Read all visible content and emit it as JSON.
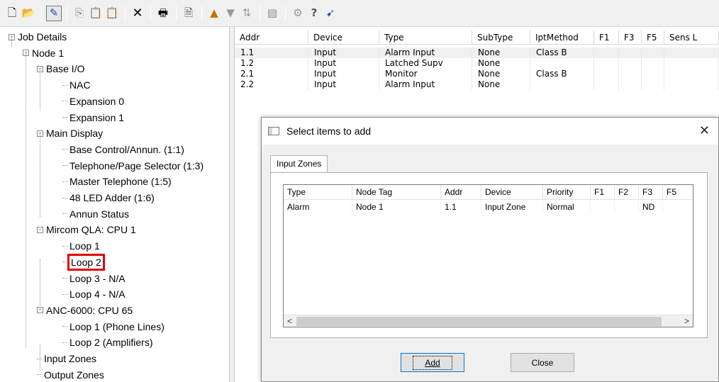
{
  "toolbar": {
    "groups": [
      [
        "new-doc-icon",
        "open-folder-icon"
      ],
      [
        "pencil-icon"
      ],
      [
        "copy-icon",
        "paste-icon",
        "paste-special-icon"
      ],
      [
        "delete-icon"
      ],
      [
        "print-icon"
      ],
      [
        "report-icon"
      ],
      [
        "upload-icon",
        "download-icon",
        "transfer-icon"
      ],
      [
        "config-icon"
      ],
      [
        "gear-icon",
        "help-icon",
        "context-help-icon"
      ]
    ]
  },
  "tree": {
    "items": [
      {
        "label": "Job Details",
        "depth": 0,
        "expander": "minus"
      },
      {
        "label": "Node 1",
        "depth": 1,
        "expander": "minus"
      },
      {
        "label": "Base I/O",
        "depth": 2,
        "expander": "minus"
      },
      {
        "label": "NAC",
        "depth": 3
      },
      {
        "label": "Expansion 0",
        "depth": 3
      },
      {
        "label": "Expansion 1",
        "depth": 3
      },
      {
        "label": "Main Display",
        "depth": 2,
        "expander": "minus"
      },
      {
        "label": "Base Control/Annun. (1:1)",
        "depth": 3
      },
      {
        "label": "Telephone/Page Selector (1:3)",
        "depth": 3
      },
      {
        "label": "Master Telephone (1:5)",
        "depth": 3
      },
      {
        "label": "48 LED Adder (1:6)",
        "depth": 3
      },
      {
        "label": "Annun Status",
        "depth": 3
      },
      {
        "label": "Mircom QLA: CPU 1",
        "depth": 2,
        "expander": "minus"
      },
      {
        "label": "Loop 1",
        "depth": 3
      },
      {
        "label": "Loop 2",
        "depth": 3,
        "highlighted": true
      },
      {
        "label": "Loop 3 - N/A",
        "depth": 3
      },
      {
        "label": "Loop 4 - N/A",
        "depth": 3
      },
      {
        "label": "ANC-6000: CPU 65",
        "depth": 2,
        "expander": "minus"
      },
      {
        "label": "Loop 1  (Phone Lines)",
        "depth": 3
      },
      {
        "label": "Loop 2  (Amplifiers)",
        "depth": 3
      },
      {
        "label": "Input Zones",
        "depth": 2
      },
      {
        "label": "Output Zones",
        "depth": 2
      }
    ]
  },
  "grid": {
    "headers": [
      "Addr",
      "Device",
      "Type",
      "SubType",
      "IptMethod",
      "F1",
      "F3",
      "F5",
      "Sens L"
    ],
    "rows": [
      [
        "1.1",
        "Input",
        "Alarm Input",
        "None",
        "Class B",
        "",
        "",
        "",
        ""
      ],
      [
        "1.2",
        "Input",
        "Latched Supv",
        "None",
        "",
        "",
        "",
        "",
        ""
      ],
      [
        "2.1",
        "Input",
        "Monitor",
        "None",
        "Class B",
        "",
        "",
        "",
        ""
      ],
      [
        "2.2",
        "Input",
        "Alarm Input",
        "None",
        "",
        "",
        "",
        "",
        ""
      ]
    ]
  },
  "dialog": {
    "title": "Select items to add",
    "close_glyph": "✕",
    "tab_label": "Input Zones",
    "list_headers": [
      "Type",
      "Node Tag",
      "Addr",
      "Device",
      "Priority",
      "F1",
      "F2",
      "F3",
      "F5"
    ],
    "list_rows": [
      [
        "Alarm",
        "Node 1",
        "1.1",
        "Input Zone",
        "Normal",
        "",
        "",
        "ND",
        ""
      ]
    ],
    "add_label": "Add",
    "close_label": "Close",
    "scroll_left": "<",
    "scroll_right": ">"
  }
}
